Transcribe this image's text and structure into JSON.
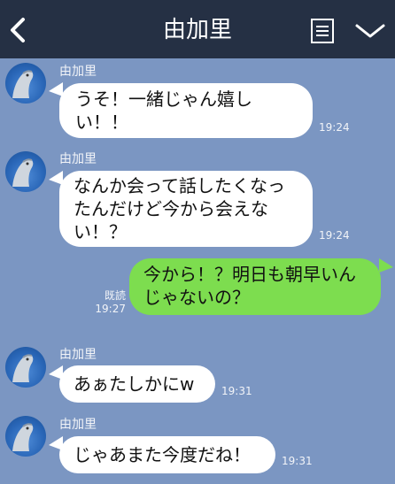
{
  "header": {
    "title": "由加里",
    "icons": [
      "chevron-left-icon",
      "note-icon",
      "chevron-down-icon"
    ]
  },
  "messages": [
    {
      "sender": "由加里",
      "text": "うそ！一緒じゃん嬉しい！！",
      "time": "19:24"
    },
    {
      "sender": "由加里",
      "text": "なんか会って話したくなったんだけど今から会えない！？",
      "time": "19:24"
    },
    {
      "read_label": "既読",
      "text": "今から！？明日も朝早いんじゃないの？",
      "time": "19:27"
    },
    {
      "sender": "由加里",
      "text": "あぁたしかにw",
      "time": "19:31"
    },
    {
      "sender": "由加里",
      "text": "じゃあまた今度だね！",
      "time": "19:31"
    }
  ],
  "colors": {
    "header_bg": "#253044",
    "chat_bg": "#7b96c2",
    "incoming_bubble": "#ffffff",
    "outgoing_bubble": "#7ddd4f"
  }
}
